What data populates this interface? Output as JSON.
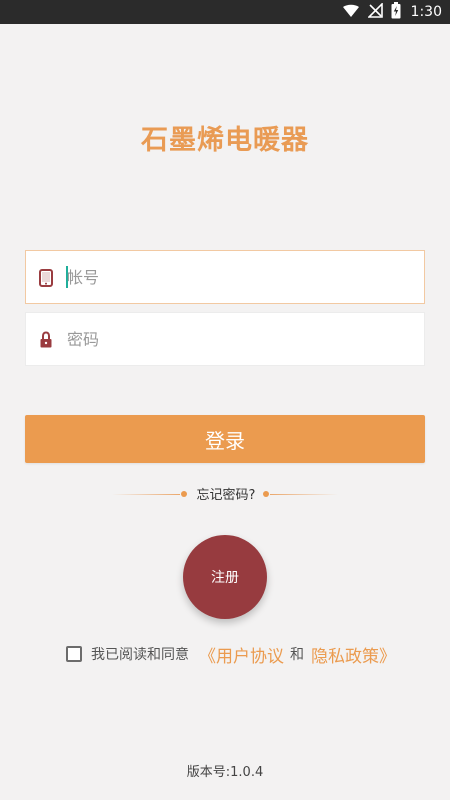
{
  "status_bar": {
    "time": "1:30"
  },
  "app": {
    "title": "石墨烯电暖器"
  },
  "login_form": {
    "account": {
      "placeholder": "帐号",
      "value": ""
    },
    "password": {
      "placeholder": "密码",
      "value": ""
    },
    "login_label": "登录",
    "forgot_password_label": "忘记密码?"
  },
  "register_label": "注册",
  "agreement": {
    "checked": false,
    "prefix": "我已阅读和同意",
    "user_agreement": "《用户协议",
    "and": "和",
    "privacy_policy": "隐私政策》"
  },
  "version": "版本号:1.0.4",
  "icons": {
    "wifi": "wifi-icon",
    "signal": "signal-off-icon",
    "battery": "battery-charging-icon",
    "phone": "phone-icon",
    "lock": "lock-icon"
  },
  "colors": {
    "accent": "#eb9b4f",
    "title": "#e99b54",
    "register": "#973b3f",
    "field_icon": "#9a3c40",
    "status_bar": "#2b2b2b",
    "background": "#f3f2f2"
  }
}
